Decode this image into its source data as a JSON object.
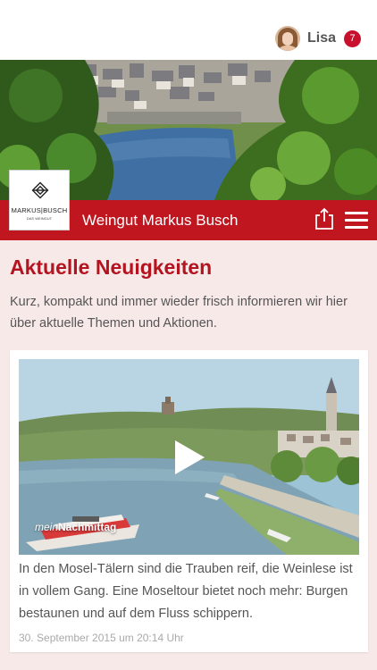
{
  "user": {
    "name": "Lisa",
    "notifications": "7"
  },
  "brand": {
    "title": "Weingut Markus Busch",
    "logo_text": "MARKUS|BUSCH",
    "logo_subtext": "DAS WEINGUT",
    "accent_color": "#c0161f"
  },
  "icons": {
    "share": "share-icon",
    "menu": "hamburger-menu-icon",
    "play": "play-icon"
  },
  "news": {
    "heading": "Aktuelle Neuigkeiten",
    "intro": "Kurz, kompakt und immer wieder frisch informieren wir hier über aktuelle Themen und Aktionen.",
    "items": [
      {
        "watermark_prefix": "mein",
        "watermark_rest": "Nachmittag",
        "text": "In den Mosel-Tälern sind die Trauben reif, die Weinlese ist in vollem Gang. Eine Moseltour bietet noch mehr: Burgen bestaunen und auf dem Fluss schippern.",
        "date": "30. September 2015 um 20:14 Uhr"
      }
    ]
  }
}
